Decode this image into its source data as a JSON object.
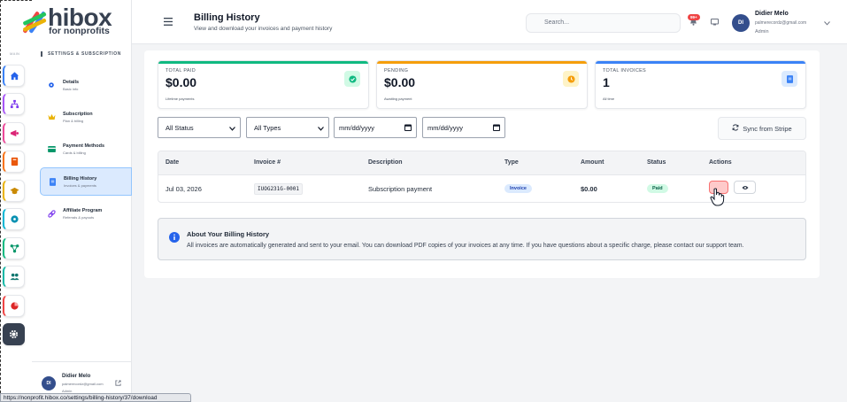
{
  "brand": {
    "name": "hibox",
    "tagline": "for nonprofits"
  },
  "rail": {
    "section_label": "MAIN"
  },
  "settings_sidebar": {
    "header": "SETTINGS & SUBSCRIPTION",
    "items": [
      {
        "title": "Details",
        "subtitle": "Basic info"
      },
      {
        "title": "Subscription",
        "subtitle": "Plan & billing"
      },
      {
        "title": "Payment Methods",
        "subtitle": "Cards & billing"
      },
      {
        "title": "Billing History",
        "subtitle": "Invoices & payments"
      },
      {
        "title": "Affiliate Program",
        "subtitle": "Referrals & payouts"
      }
    ],
    "user": {
      "initials": "DI",
      "name": "Didier Melo",
      "email": "palmerecordz@gmail.com",
      "role": "Admin"
    }
  },
  "header": {
    "title": "Billing History",
    "subtitle": "View and download your invoices and payment history",
    "search_placeholder": "Search...",
    "notification_count": "99+",
    "user": {
      "initials": "DI",
      "name": "Didier Melo",
      "email": "palmerecordz@gmail.com",
      "role": "Admin"
    }
  },
  "stats": [
    {
      "label": "TOTAL PAID",
      "value": "$0.00",
      "sub": "Lifetime payments",
      "color": "#10b981"
    },
    {
      "label": "PENDING",
      "value": "$0.00",
      "sub": "Awaiting payment",
      "color": "#f59e0b"
    },
    {
      "label": "TOTAL INVOICES",
      "value": "1",
      "sub": "All time",
      "color": "#3b82f6"
    }
  ],
  "filters": {
    "status": "All Status",
    "type": "All Types",
    "date_from": "mm/dd/yyyy",
    "date_to": "mm/dd/yyyy",
    "sync_label": "Sync from Stripe"
  },
  "table": {
    "columns": [
      "Date",
      "Invoice #",
      "Description",
      "Type",
      "Amount",
      "Status",
      "Actions"
    ],
    "rows": [
      {
        "date": "Jul 03, 2026",
        "invoice": "IUOG231G-0001",
        "description": "Subscription payment",
        "type": "Invoice",
        "amount": "$0.00",
        "status": "Paid"
      }
    ]
  },
  "info": {
    "title": "About Your Billing History",
    "text": "All invoices are automatically generated and sent to your email. You can download PDF copies of your invoices at any time. If you have questions about a specific charge, please contact our support team."
  },
  "status_url": "https://nonprofit.hibox.co/settings/billing-history/37/download"
}
